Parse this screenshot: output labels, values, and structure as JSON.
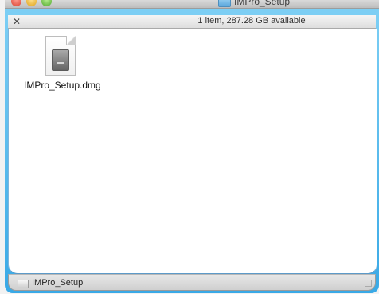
{
  "window": {
    "title": "IMPro_Setup",
    "status": "1 item, 287.28 GB available",
    "toolbar_icon": "tool-icon"
  },
  "content": {
    "items": [
      {
        "name": "IMPro_Setup.dmg",
        "icon": "dmg-file-icon"
      }
    ]
  },
  "pathbar": {
    "label": "IMPro_Setup",
    "icon": "folder-icon"
  },
  "colors": {
    "window_frame": "#39a9e6",
    "content_background": "#ffffff",
    "statusbar_background": "#d8d8d8"
  }
}
